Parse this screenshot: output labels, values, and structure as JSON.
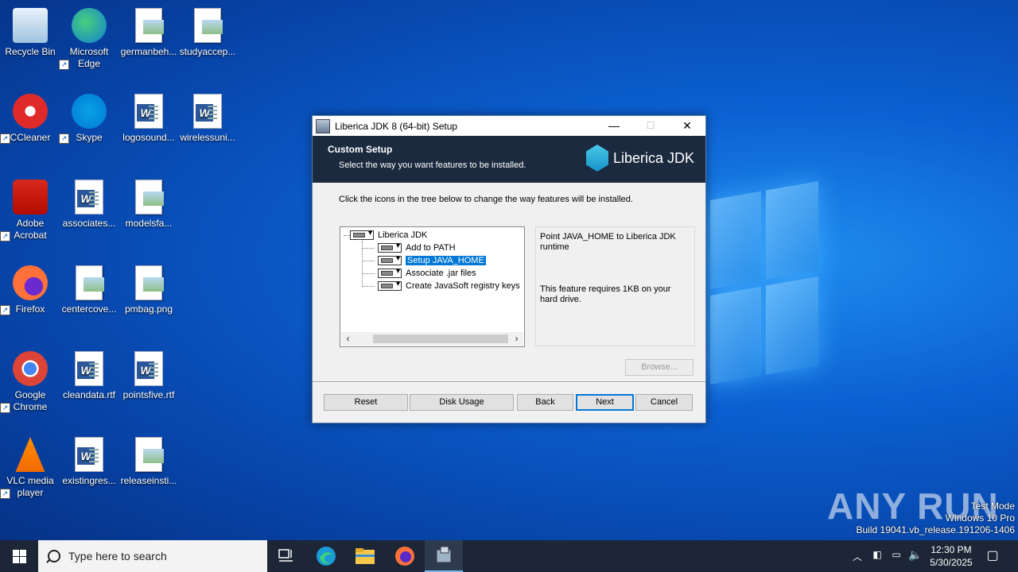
{
  "desktop": {
    "icons": [
      {
        "label": "Recycle Bin",
        "icon": "recycle-bin-icon"
      },
      {
        "label": "Microsoft Edge",
        "icon": "edge-icon"
      },
      {
        "label": "germanbeh...",
        "icon": "image-file-icon"
      },
      {
        "label": "studyaccep...",
        "icon": "image-file-icon"
      },
      {
        "label": "CCleaner",
        "icon": "ccleaner-icon"
      },
      {
        "label": "Skype",
        "icon": "skype-icon"
      },
      {
        "label": "logosound...",
        "icon": "word-doc-icon"
      },
      {
        "label": "wirelessuni...",
        "icon": "word-doc-icon"
      },
      {
        "label": "Adobe Acrobat",
        "icon": "acrobat-icon"
      },
      {
        "label": "associates...",
        "icon": "word-doc-icon"
      },
      {
        "label": "modelsfa...",
        "icon": "image-file-icon"
      },
      {
        "label": "Firefox",
        "icon": "firefox-icon"
      },
      {
        "label": "centercove...",
        "icon": "image-file-icon"
      },
      {
        "label": "pmbag.png",
        "icon": "image-file-icon"
      },
      {
        "label": "Google Chrome",
        "icon": "chrome-icon"
      },
      {
        "label": "cleandata.rtf",
        "icon": "word-doc-icon"
      },
      {
        "label": "pointsfive.rtf",
        "icon": "word-doc-icon"
      },
      {
        "label": "VLC media player",
        "icon": "vlc-icon"
      },
      {
        "label": "existingres...",
        "icon": "word-doc-icon"
      },
      {
        "label": "releaseinsti...",
        "icon": "image-file-icon"
      }
    ]
  },
  "dialog": {
    "title": "Liberica JDK 8 (64-bit) Setup",
    "minimize": "—",
    "maximize": "☐",
    "close": "✕",
    "header_title": "Custom Setup",
    "header_subtitle": "Select the way you want features to be installed.",
    "brand": "Liberica JDK",
    "instruction": "Click the icons in the tree below to change the way features will be installed.",
    "tree": {
      "root": "Liberica JDK",
      "children": [
        "Add to PATH",
        "Setup JAVA_HOME",
        "Associate .jar files",
        "Create JavaSoft registry keys"
      ],
      "selected": "Setup JAVA_HOME"
    },
    "description": "Point JAVA_HOME to Liberica JDK runtime",
    "size_note": "This feature requires 1KB on your hard drive.",
    "browse_label": "Browse...",
    "buttons": {
      "reset": "Reset",
      "disk_usage": "Disk Usage",
      "back": "Back",
      "next": "Next",
      "cancel": "Cancel"
    }
  },
  "taskbar": {
    "search_placeholder": "Type here to search",
    "time": "12:30 PM",
    "date": "5/30/2025"
  },
  "watermark": {
    "brand": "ANY RUN",
    "line1": "Test Mode",
    "line2": "Windows 10 Pro",
    "line3": "Build 19041.vb_release.191206-1406"
  }
}
